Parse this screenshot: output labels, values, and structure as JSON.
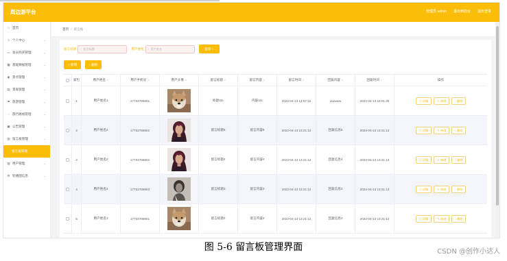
{
  "app": {
    "brand": "周边游平台",
    "header_links": [
      "管理员 admin",
      "退出到前台",
      "退出登录"
    ]
  },
  "sidebar": {
    "items": [
      {
        "label": "首页",
        "icon": "home-icon",
        "glyph": "⌂",
        "chevron": false
      },
      {
        "label": "个人中心",
        "icon": "person-icon",
        "glyph": "☺",
        "chevron": true
      },
      {
        "label": "会员购买管理",
        "icon": "cart-icon",
        "glyph": "▭",
        "chevron": true
      },
      {
        "label": "基础数据管理",
        "icon": "grid-icon",
        "glyph": "▦",
        "chevron": true
      },
      {
        "label": "景点管理",
        "icon": "location-icon",
        "glyph": "◉",
        "chevron": true
      },
      {
        "label": "景观管理",
        "icon": "picture-icon",
        "glyph": "▤",
        "chevron": true
      },
      {
        "label": "旅游管理",
        "icon": "flag-icon",
        "glyph": "⚑",
        "chevron": true
      },
      {
        "label": "旅行路线管理",
        "icon": "route-icon",
        "glyph": "◌",
        "chevron": true
      },
      {
        "label": "公告管理",
        "icon": "bell-icon",
        "glyph": "▣",
        "chevron": true
      },
      {
        "label": "留言板管理",
        "icon": "message-icon",
        "glyph": "▥",
        "chevron": true
      },
      {
        "label": "留言板管理",
        "icon": "",
        "glyph": "",
        "chevron": false,
        "active": true,
        "sub": true
      },
      {
        "label": "用户管理",
        "icon": "users-icon",
        "glyph": "▧",
        "chevron": true
      },
      {
        "label": "轮播图信息",
        "icon": "gear-icon",
        "glyph": "⚙",
        "chevron": true
      }
    ]
  },
  "breadcrumb": {
    "home": "首页",
    "current": "留言板"
  },
  "search": {
    "label1": "留言标题",
    "placeholder1": "留言标题",
    "label2": "用户姓名",
    "placeholder2": "用户姓名",
    "button": "查询"
  },
  "actions": {
    "add": "新增",
    "delete": "删除"
  },
  "table": {
    "headers": [
      "",
      "索引",
      "用户姓名",
      "用户手机号",
      "用户头像",
      "留言标题",
      "留言内容",
      "留言时间",
      "回复内容",
      "回复时间",
      "操作"
    ],
    "op_labels": [
      "详情",
      "修改",
      "删除"
    ],
    "rows": [
      {
        "index": "1",
        "name": "用户姓名1",
        "phone": "17703786901",
        "avatar": "dog",
        "title": "标题111",
        "content": "内容111",
        "time": "2022-04-13 14:57:32",
        "reply": "wwwww",
        "reply_time": "2022-04-13 15:01:30"
      },
      {
        "index": "2",
        "name": "用户姓名2",
        "phone": "17703786902",
        "avatar": "woman",
        "title": "留言标题5",
        "content": "留言内容5",
        "time": "2022-04-13 13:21:12",
        "reply": "回复信息5",
        "reply_time": "2022-04-13 13:21:12"
      },
      {
        "index": "3",
        "name": "用户姓名2",
        "phone": "17703786902",
        "avatar": "woman",
        "title": "留言标题4",
        "content": "留言内容4",
        "time": "2022-04-13 13:21:12",
        "reply": "回复信息4",
        "reply_time": "2022-04-13 13:21:12"
      },
      {
        "index": "4",
        "name": "用户姓名3",
        "phone": "17703786903",
        "avatar": "man",
        "title": "留言标题3",
        "content": "留言内容3",
        "time": "2022-04-13 13:21:12",
        "reply": "回复信息3",
        "reply_time": "2022-04-13 13:21:12"
      },
      {
        "index": "5",
        "name": "用户姓名1",
        "phone": "17703786901",
        "avatar": "dog",
        "title": "留言标题2",
        "content": "留言内容2",
        "time": "2022-04-13 13:21:12",
        "reply": "回复信息2",
        "reply_time": "2022-04-13 13:21:12"
      }
    ]
  },
  "caption": "图 5-6  留言板管理界面",
  "watermark": "CSDN @创作小达人",
  "colors": {
    "accent": "#fbbd08",
    "row_alt": "#f3f5fa"
  }
}
